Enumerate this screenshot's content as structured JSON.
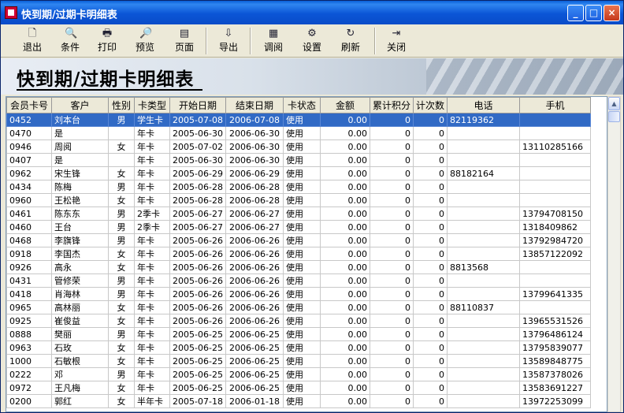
{
  "window": {
    "title": "快到期/过期卡明细表",
    "minimize": "_",
    "maximize": "□",
    "close": "×"
  },
  "toolbar": [
    {
      "label": "退出",
      "icon": "page-icon"
    },
    {
      "label": "条件",
      "icon": "search-page-icon"
    },
    {
      "label": "打印",
      "icon": "printer-icon"
    },
    {
      "label": "预览",
      "icon": "preview-icon"
    },
    {
      "label": "页面",
      "icon": "page-setup-icon"
    },
    {
      "label": "导出",
      "icon": "export-icon"
    },
    {
      "label": "调阅",
      "icon": "browse-icon"
    },
    {
      "label": "设置",
      "icon": "settings-icon"
    },
    {
      "label": "刷新",
      "icon": "refresh-icon"
    },
    {
      "label": "关闭",
      "icon": "exit-door-icon"
    }
  ],
  "banner": {
    "title": "快到期/过期卡明细表"
  },
  "columns": [
    "会员卡号",
    "客户",
    "性别",
    "卡类型",
    "开始日期",
    "结束日期",
    "卡状态",
    "金额",
    "累计积分",
    "计次数",
    "电话",
    "手机"
  ],
  "rows": [
    [
      "0452",
      "刘本台",
      "男",
      "学生卡",
      "2005-07-08",
      "2006-07-08",
      "使用",
      "0.00",
      "0",
      "0",
      "82119362",
      ""
    ],
    [
      "0470",
      "是",
      "",
      "年卡",
      "2005-06-30",
      "2006-06-30",
      "使用",
      "0.00",
      "0",
      "0",
      "",
      ""
    ],
    [
      "0946",
      "周阅",
      "女",
      "年卡",
      "2005-07-02",
      "2006-06-30",
      "使用",
      "0.00",
      "0",
      "0",
      "",
      "13110285166"
    ],
    [
      "0407",
      "是",
      "",
      "年卡",
      "2005-06-30",
      "2006-06-30",
      "使用",
      "0.00",
      "0",
      "0",
      "",
      ""
    ],
    [
      "0962",
      "宋生锋",
      "女",
      "年卡",
      "2005-06-29",
      "2006-06-29",
      "使用",
      "0.00",
      "0",
      "0",
      "88182164",
      ""
    ],
    [
      "0434",
      "陈梅",
      "男",
      "年卡",
      "2005-06-28",
      "2006-06-28",
      "使用",
      "0.00",
      "0",
      "0",
      "",
      ""
    ],
    [
      "0960",
      "王松艳",
      "女",
      "年卡",
      "2005-06-28",
      "2006-06-28",
      "使用",
      "0.00",
      "0",
      "0",
      "",
      ""
    ],
    [
      "0461",
      "陈东东",
      "男",
      "2季卡",
      "2005-06-27",
      "2006-06-27",
      "使用",
      "0.00",
      "0",
      "0",
      "",
      "13794708150"
    ],
    [
      "0460",
      "王台",
      "男",
      "2季卡",
      "2005-06-27",
      "2006-06-27",
      "使用",
      "0.00",
      "0",
      "0",
      "",
      "1318409862"
    ],
    [
      "0468",
      "李旗锋",
      "男",
      "年卡",
      "2005-06-26",
      "2006-06-26",
      "使用",
      "0.00",
      "0",
      "0",
      "",
      "13792984720"
    ],
    [
      "0918",
      "李国杰",
      "女",
      "年卡",
      "2005-06-26",
      "2006-06-26",
      "使用",
      "0.00",
      "0",
      "0",
      "",
      "13857122092"
    ],
    [
      "0926",
      "高永",
      "女",
      "年卡",
      "2005-06-26",
      "2006-06-26",
      "使用",
      "0.00",
      "0",
      "0",
      "8813568",
      ""
    ],
    [
      "0431",
      "管修荣",
      "男",
      "年卡",
      "2005-06-26",
      "2006-06-26",
      "使用",
      "0.00",
      "0",
      "0",
      "",
      ""
    ],
    [
      "0418",
      "肖海林",
      "男",
      "年卡",
      "2005-06-26",
      "2006-06-26",
      "使用",
      "0.00",
      "0",
      "0",
      "",
      "13799641335"
    ],
    [
      "0965",
      "高林丽",
      "女",
      "年卡",
      "2005-06-26",
      "2006-06-26",
      "使用",
      "0.00",
      "0",
      "0",
      "88110837",
      ""
    ],
    [
      "0925",
      "崔俊益",
      "女",
      "年卡",
      "2005-06-26",
      "2006-06-26",
      "使用",
      "0.00",
      "0",
      "0",
      "",
      "13965531526"
    ],
    [
      "0888",
      "樊丽",
      "男",
      "年卡",
      "2005-06-25",
      "2006-06-25",
      "使用",
      "0.00",
      "0",
      "0",
      "",
      "13796486124"
    ],
    [
      "0963",
      "石玫",
      "女",
      "年卡",
      "2005-06-25",
      "2006-06-25",
      "使用",
      "0.00",
      "0",
      "0",
      "",
      "13795839077"
    ],
    [
      "1000",
      "石敏根",
      "女",
      "年卡",
      "2005-06-25",
      "2006-06-25",
      "使用",
      "0.00",
      "0",
      "0",
      "",
      "13589848775"
    ],
    [
      "0222",
      "邓",
      "男",
      "年卡",
      "2005-06-25",
      "2006-06-25",
      "使用",
      "0.00",
      "0",
      "0",
      "",
      "13587378026"
    ],
    [
      "0972",
      "王凡梅",
      "女",
      "年卡",
      "2005-06-25",
      "2006-06-25",
      "使用",
      "0.00",
      "0",
      "0",
      "",
      "13583691227"
    ],
    [
      "0200",
      "郭红",
      "女",
      "半年卡",
      "2005-07-18",
      "2006-01-18",
      "使用",
      "0.00",
      "0",
      "0",
      "",
      "13972253099"
    ]
  ]
}
